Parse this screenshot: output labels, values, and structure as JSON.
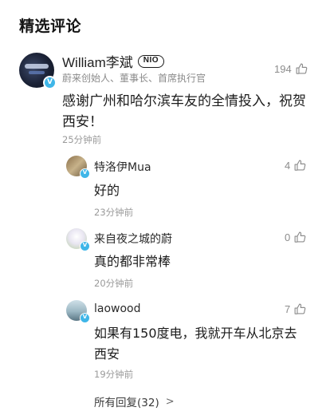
{
  "section_title": "精选评论",
  "main_comment": {
    "author": "William李斌",
    "badge": "NIO",
    "subtitle": "蔚来创始人、董事长、首席执行官",
    "likes": "194",
    "text": "感谢广州和哈尔滨车友的全情投入，祝贺西安！",
    "time": "25分钟前"
  },
  "replies": [
    {
      "author": "特洛伊Mua",
      "likes": "4",
      "text": "好的",
      "time": "23分钟前"
    },
    {
      "author": "来自夜之城的蔚",
      "likes": "0",
      "text": "真的都非常棒",
      "time": "20分钟前"
    },
    {
      "author": "laowood",
      "likes": "7",
      "text": "如果有150度电，我就开车从北京去西安",
      "time": "19分钟前"
    }
  ],
  "all_replies_label": "所有回复(32)",
  "verified_badge_glyph": "V",
  "icons": [
    "thumbs-up-icon",
    "verified-icon",
    "chevron-right-icon"
  ],
  "colors": {
    "verified": "#3fb6e8",
    "text": "#1c1c1c",
    "muted": "#9a9a9a"
  }
}
